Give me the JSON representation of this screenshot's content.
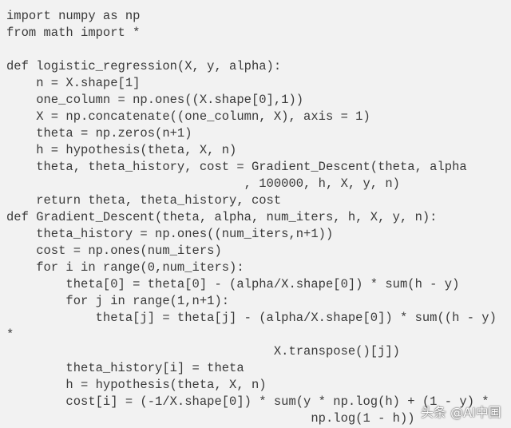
{
  "code": {
    "language": "python",
    "lines": [
      "import numpy as np",
      "from math import *",
      "",
      "def logistic_regression(X, y, alpha):",
      "    n = X.shape[1]",
      "    one_column = np.ones((X.shape[0],1))",
      "    X = np.concatenate((one_column, X), axis = 1)",
      "    theta = np.zeros(n+1)",
      "    h = hypothesis(theta, X, n)",
      "    theta, theta_history, cost = Gradient_Descent(theta, alpha",
      "                                , 100000, h, X, y, n)",
      "    return theta, theta_history, cost",
      "def Gradient_Descent(theta, alpha, num_iters, h, X, y, n):",
      "    theta_history = np.ones((num_iters,n+1))",
      "    cost = np.ones(num_iters)",
      "    for i in range(0,num_iters):",
      "        theta[0] = theta[0] - (alpha/X.shape[0]) * sum(h - y)",
      "        for j in range(1,n+1):",
      "            theta[j] = theta[j] - (alpha/X.shape[0]) * sum((h - y)",
      "*",
      "                                    X.transpose()[j])",
      "        theta_history[i] = theta",
      "        h = hypothesis(theta, X, n)",
      "        cost[i] = (-1/X.shape[0]) * sum(y * np.log(h) + (1 - y) *",
      "                                         np.log(1 - h))"
    ]
  },
  "watermark": {
    "text": "头条 @AI中国"
  }
}
